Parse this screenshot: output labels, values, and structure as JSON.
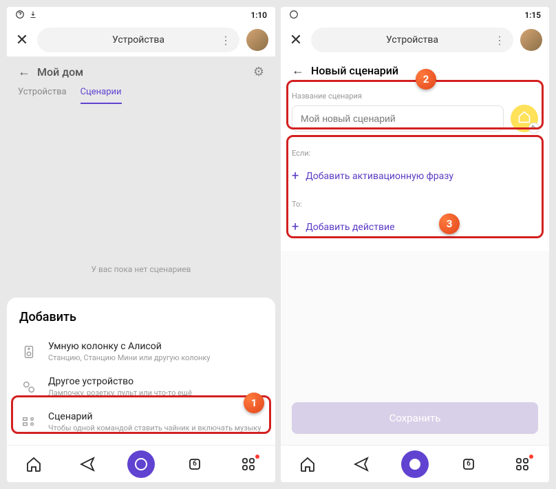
{
  "left": {
    "status": {
      "time": "1:10"
    },
    "header": {
      "title": "Устройства"
    },
    "dim": {
      "title": "Мой дом",
      "tabs": {
        "devices": "Устройства",
        "scenarios": "Сценарии"
      },
      "empty": "У вас пока нет сценариев"
    },
    "sheet": {
      "title": "Добавить",
      "items": [
        {
          "label": "Умную колонку с Алисой",
          "desc": "Станцию, Станцию Мини или другую колонку"
        },
        {
          "label": "Другое устройство",
          "desc": "Лампочку, розетку, пульт или что-то ещё"
        },
        {
          "label": "Сценарий",
          "desc": "Чтобы одной командой ставить чайник и включать музыку"
        }
      ]
    },
    "nav": {
      "badge": "6"
    }
  },
  "right": {
    "status": {
      "time": "1:15"
    },
    "header": {
      "title": "Устройства"
    },
    "page": {
      "title": "Новый сценарий",
      "name_label": "Название сценария",
      "name_placeholder": "Мой новый сценарий",
      "if_label": "Если:",
      "add_phrase": "Добавить активационную фразу",
      "then_label": "То:",
      "add_action": "Добавить действие",
      "save": "Сохранить"
    },
    "nav": {
      "badge": "6"
    }
  },
  "callouts": {
    "one": "1",
    "two": "2",
    "three": "3"
  }
}
